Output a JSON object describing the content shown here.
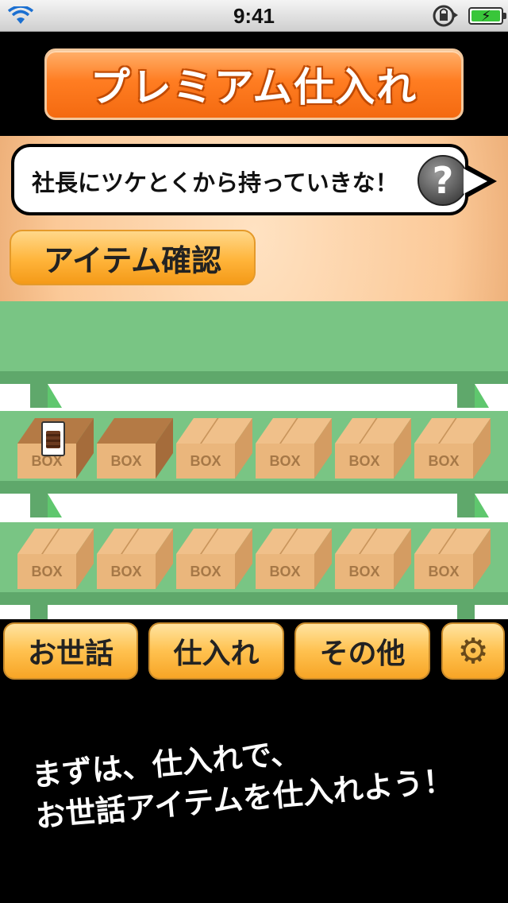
{
  "status_bar": {
    "time": "9:41",
    "icons": [
      "wifi-icon",
      "rotation-lock-icon",
      "battery-charging-icon"
    ]
  },
  "premium_button": {
    "label": "プレミアム仕入れ"
  },
  "speech_bubble": {
    "text": "社長にツケとくから持っていきな！",
    "help_icon": "?"
  },
  "item_check_button": {
    "label": "アイテム確認"
  },
  "shelf": {
    "box_label": "BOX",
    "row1": [
      {
        "state": "open",
        "has_item": true
      },
      {
        "state": "open",
        "has_item": false
      },
      {
        "state": "closed",
        "has_item": false
      },
      {
        "state": "closed",
        "has_item": false
      },
      {
        "state": "closed",
        "has_item": false
      },
      {
        "state": "closed",
        "has_item": false
      }
    ],
    "row2": [
      {
        "state": "closed",
        "has_item": false
      },
      {
        "state": "closed",
        "has_item": false
      },
      {
        "state": "closed",
        "has_item": false
      },
      {
        "state": "closed",
        "has_item": false
      },
      {
        "state": "closed",
        "has_item": false
      },
      {
        "state": "closed",
        "has_item": false
      }
    ]
  },
  "tabs": {
    "care": "お世話",
    "stock": "仕入れ",
    "other": "その他",
    "settings_icon": "⚙"
  },
  "tutorial": {
    "text": "まずは、仕入れで、\nお世話アイテムを仕入れよう！"
  },
  "colors": {
    "accent": "#ff7d22",
    "shelf": "#79c584",
    "tab": "#ffc14f"
  }
}
